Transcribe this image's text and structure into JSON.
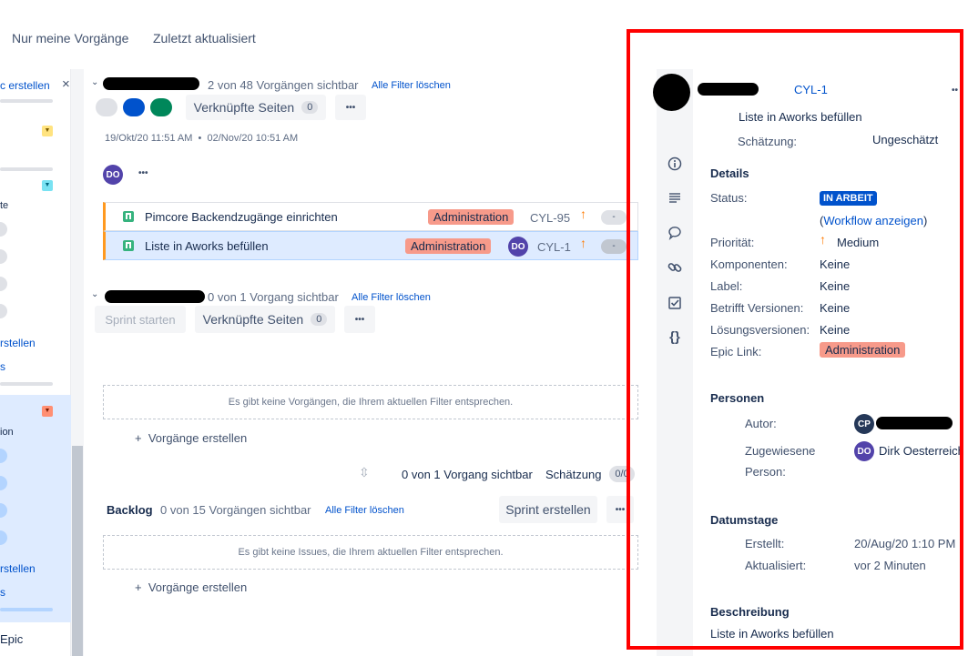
{
  "topbar": {
    "filter_my_issues": "Nur meine Vorgänge",
    "filter_recent": "Zuletzt aktualisiert"
  },
  "sidebar": {
    "create_link": "c erstellen",
    "close_symbol": "×",
    "label_te": "te",
    "create2": "rstellen",
    "s1": "s",
    "label_ion": "ion",
    "create3": "rstellen",
    "s2": "s",
    "epic": "Epic"
  },
  "sprint1": {
    "visible": "2 von 48 Vorgängen sichtbar",
    "clear_filters": "Alle Filter löschen",
    "linked_pages": "Verknüpfte Seiten",
    "linked_count": "0",
    "more": "•••",
    "dates": "19/Okt/20 11:51 AM  •  02/Nov/20 10:51 AM",
    "assignee_initials": "DO",
    "more2": "•••",
    "issues": [
      {
        "summary": "Pimcore Backendzugänge einrichten",
        "epic": "Administration",
        "key": "CYL-95",
        "estimate": "-"
      },
      {
        "summary": "Liste in Aworks befüllen",
        "epic": "Administration",
        "avatar": "DO",
        "key": "CYL-1",
        "estimate": "-"
      }
    ]
  },
  "sprint2": {
    "visible": "0 von 1 Vorgang sichtbar",
    "clear_filters": "Alle Filter löschen",
    "start_sprint": "Sprint starten",
    "linked_pages": "Verknüpfte Seiten",
    "linked_count": "0",
    "more": "•••",
    "empty": "Es gibt keine Vorgängen, die Ihrem aktuellen Filter entsprechen.",
    "create": "+  Vorgänge erstellen",
    "footer_visible": "0 von 1 Vorgang sichtbar",
    "footer_estimate": "Schätzung",
    "footer_estimate_val": "0/0"
  },
  "backlog": {
    "title": "Backlog",
    "visible": "0 von 15 Vorgängen sichtbar",
    "clear_filters": "Alle Filter löschen",
    "create_sprint": "Sprint erstellen",
    "more": "•••",
    "empty": "Es gibt keine Issues, die Ihrem aktuellen Filter entsprechen.",
    "create": "+  Vorgänge erstellen"
  },
  "detail": {
    "key": "CYL-1",
    "more": "••",
    "summary": "Liste in Aworks befüllen",
    "estimate_label": "Schätzung:",
    "estimate_value": "Ungeschätzt",
    "details_title": "Details",
    "status_label": "Status:",
    "status_value": "IN ARBEIT",
    "workflow_open": "(",
    "workflow_link": "Workflow anzeigen",
    "workflow_close": ")",
    "priority_label": "Priorität:",
    "priority_value": "Medium",
    "components_label": "Komponenten:",
    "components_value": "Keine",
    "label_label": "Label:",
    "label_value": "Keine",
    "affects_label": "Betrifft Versionen:",
    "affects_value": "Keine",
    "fix_label": "Lösungsversionen:",
    "fix_value": "Keine",
    "epic_label": "Epic Link:",
    "epic_value": "Administration",
    "people_title": "Personen",
    "author_label": "Autor:",
    "author_initials": "CP",
    "assignee_label_1": "Zugewiesene",
    "assignee_label_2": "Person:",
    "assignee_initials": "DO",
    "assignee_name": "Dirk Oesterreich",
    "dates_title": "Datumstage",
    "created_label": "Erstellt:",
    "created_value": "20/Aug/20 1:10 PM",
    "updated_label": "Aktualisiert:",
    "updated_value": "vor 2 Minuten",
    "desc_title": "Beschreibung",
    "desc_value": "Liste in Aworks befüllen"
  },
  "colors": {
    "accent": "#0052cc",
    "status_bg": "#0052cc",
    "epic_lozenge": "#f79a8a",
    "highlight_row": "#deebff",
    "annotation": "#ff0000",
    "avatar_purple": "#5243aa",
    "avatar_navy": "#253858",
    "priority_orange": "#ff7a00"
  }
}
